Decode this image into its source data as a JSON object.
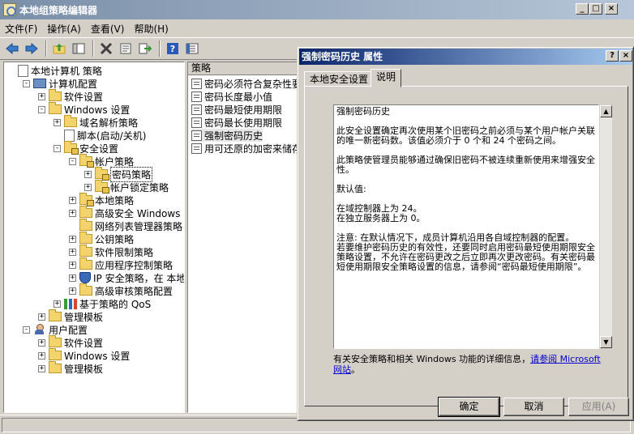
{
  "main_window": {
    "title": "本地组策略编辑器",
    "controls": {
      "minimize": "_",
      "maximize": "□",
      "close": "×"
    }
  },
  "menu": [
    "文件(F)",
    "操作(A)",
    "查看(V)",
    "帮助(H)"
  ],
  "toolbar_icons": [
    "back-icon",
    "forward-icon",
    "up-icon",
    "show-hide-tree-icon",
    "delete-icon",
    "properties-icon",
    "export-icon",
    "help-icon",
    "help-topics-icon"
  ],
  "tree": [
    {
      "label": "本地计算机 策略",
      "depth": 0,
      "exp": "none",
      "icon": "doc"
    },
    {
      "label": "计算机配置",
      "depth": 1,
      "exp": "-",
      "icon": "pc"
    },
    {
      "label": "软件设置",
      "depth": 2,
      "exp": "+",
      "icon": "folder"
    },
    {
      "label": "Windows 设置",
      "depth": 2,
      "exp": "-",
      "icon": "folder"
    },
    {
      "label": "域名解析策略",
      "depth": 3,
      "exp": "+",
      "icon": "folder"
    },
    {
      "label": "脚本(启动/关机)",
      "depth": 3,
      "exp": "none",
      "icon": "doc"
    },
    {
      "label": "安全设置",
      "depth": 3,
      "exp": "-",
      "icon": "folder-lock"
    },
    {
      "label": "帐户策略",
      "depth": 4,
      "exp": "-",
      "icon": "folder-lock"
    },
    {
      "label": "密码策略",
      "depth": 5,
      "exp": "+",
      "icon": "folder-lock",
      "selected": true
    },
    {
      "label": "帐户锁定策略",
      "depth": 5,
      "exp": "+",
      "icon": "folder-lock"
    },
    {
      "label": "本地策略",
      "depth": 4,
      "exp": "+",
      "icon": "folder-lock"
    },
    {
      "label": "高级安全 Windows 防火",
      "depth": 4,
      "exp": "+",
      "icon": "folder"
    },
    {
      "label": "网络列表管理器策略",
      "depth": 4,
      "exp": "none",
      "icon": "folder"
    },
    {
      "label": "公钥策略",
      "depth": 4,
      "exp": "+",
      "icon": "folder"
    },
    {
      "label": "软件限制策略",
      "depth": 4,
      "exp": "+",
      "icon": "folder"
    },
    {
      "label": "应用程序控制策略",
      "depth": 4,
      "exp": "+",
      "icon": "folder"
    },
    {
      "label": "IP 安全策略，在 本地",
      "depth": 4,
      "exp": "+",
      "icon": "shield"
    },
    {
      "label": "高级审核策略配置",
      "depth": 4,
      "exp": "+",
      "icon": "folder"
    },
    {
      "label": "基于策略的 QoS",
      "depth": 3,
      "exp": "+",
      "icon": "chart"
    },
    {
      "label": "管理模板",
      "depth": 2,
      "exp": "+",
      "icon": "folder"
    },
    {
      "label": "用户配置",
      "depth": 1,
      "exp": "-",
      "icon": "user"
    },
    {
      "label": "软件设置",
      "depth": 2,
      "exp": "+",
      "icon": "folder"
    },
    {
      "label": "Windows 设置",
      "depth": 2,
      "exp": "+",
      "icon": "folder"
    },
    {
      "label": "管理模板",
      "depth": 2,
      "exp": "+",
      "icon": "folder"
    }
  ],
  "list": {
    "header": "策略",
    "items": [
      "密码必须符合复杂性要",
      "密码长度最小值",
      "密码最短使用期限",
      "密码最长使用期限",
      "强制密码历史",
      "用可还原的加密来储存"
    ],
    "selected_index": 4
  },
  "dialog": {
    "title": "强制密码历史 属性",
    "controls": {
      "help": "?",
      "close": "×"
    },
    "tabs": [
      "本地安全设置",
      "说明"
    ],
    "active_tab": 1,
    "help_paragraphs": [
      "强制密码历史",
      "此安全设置确定再次使用某个旧密码之前必须与某个用户帐户关联的唯一新密码数。该值必须介于 0 个和 24 个密码之间。",
      "此策略使管理员能够通过确保旧密码不被连续重新使用来增强安全性。",
      "默认值:",
      "在域控制器上为 24。\n在独立服务器上为 0。",
      "注意: 在默认情况下，成员计算机沿用各自域控制器的配置。\n若要维护密码历史的有效性，还要同时启用密码最短使用期限安全策略设置，不允许在密码更改之后立即再次更改密码。有关密码最短使用期限安全策略设置的信息，请参阅“密码最短使用期限”。"
    ],
    "more_info_text": "有关安全策略和相关 Windows 功能的详细信息，",
    "more_info_link": "请参阅 Microsoft 网站",
    "more_info_end": "。",
    "buttons": {
      "ok": "确定",
      "cancel": "取消",
      "apply": "应用(A)"
    }
  }
}
